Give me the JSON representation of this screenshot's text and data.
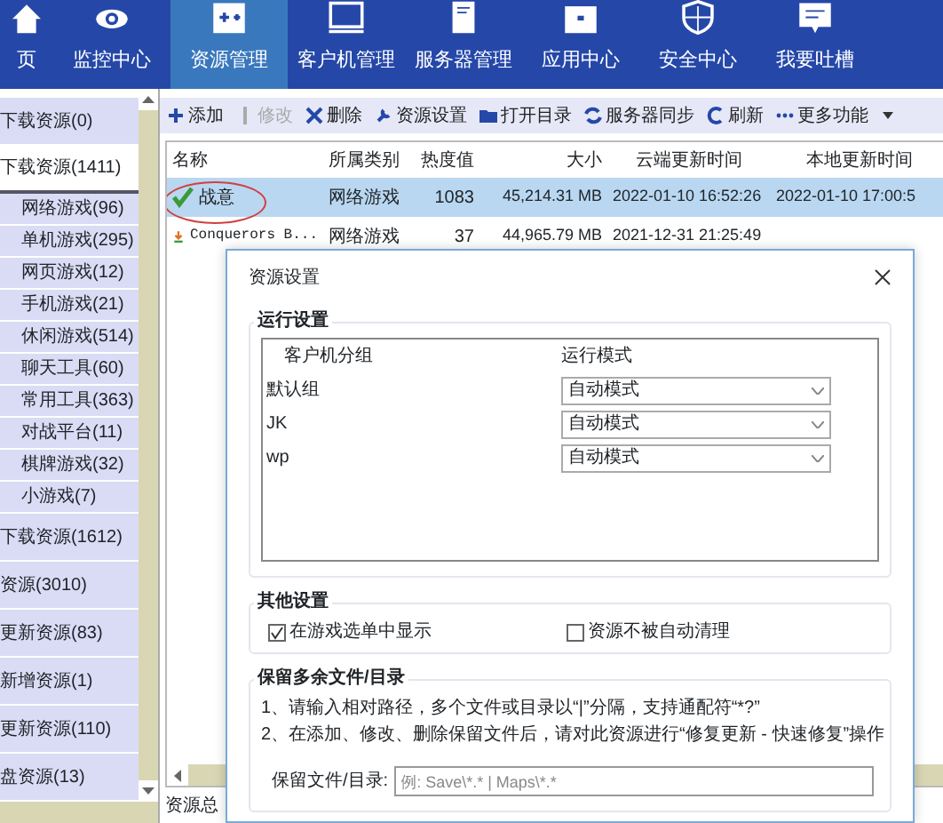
{
  "nav": [
    {
      "label": "页",
      "kind": "home",
      "selected": false
    },
    {
      "label": "监控中心",
      "kind": "eye",
      "selected": false
    },
    {
      "label": "资源管理",
      "kind": "plus",
      "selected": true
    },
    {
      "label": "客户机管理",
      "kind": "monitor",
      "selected": false
    },
    {
      "label": "服务器管理",
      "kind": "server",
      "selected": false
    },
    {
      "label": "应用中心",
      "kind": "box",
      "selected": false
    },
    {
      "label": "安全中心",
      "kind": "shield",
      "selected": false
    },
    {
      "label": "我要吐槽",
      "kind": "chat",
      "selected": false
    }
  ],
  "sidebar": {
    "items": [
      {
        "label": "下载资源(0)",
        "selected": false
      },
      {
        "label": "下载资源(1411)",
        "selected": true,
        "children": [
          {
            "label": "网络游戏(96)"
          },
          {
            "label": "单机游戏(295)"
          },
          {
            "label": "网页游戏(12)"
          },
          {
            "label": "手机游戏(21)"
          },
          {
            "label": "休闲游戏(514)"
          },
          {
            "label": "聊天工具(60)"
          },
          {
            "label": "常用工具(363)"
          },
          {
            "label": "对战平台(11)"
          },
          {
            "label": "棋牌游戏(32)"
          },
          {
            "label": "小游戏(7)"
          }
        ]
      },
      {
        "label": "下载资源(1612)",
        "selected": false
      },
      {
        "label": "资源(3010)",
        "selected": false
      },
      {
        "label": "更新资源(83)",
        "selected": false
      },
      {
        "label": "新增资源(1)",
        "selected": false
      },
      {
        "label": "更新资源(110)",
        "selected": false
      },
      {
        "label": "盘资源(13)",
        "selected": false
      }
    ]
  },
  "toolbar": [
    {
      "label": "添加",
      "kind": "add",
      "disabled": false
    },
    {
      "label": "修改",
      "kind": "edit",
      "disabled": true
    },
    {
      "label": "删除",
      "kind": "delete",
      "disabled": false
    },
    {
      "label": "资源设置",
      "kind": "wrench",
      "disabled": false
    },
    {
      "label": "打开目录",
      "kind": "folder",
      "disabled": false
    },
    {
      "label": "服务器同步",
      "kind": "sync",
      "disabled": false
    },
    {
      "label": "刷新",
      "kind": "refresh",
      "disabled": false
    },
    {
      "label": "更多功能",
      "kind": "more",
      "disabled": false
    }
  ],
  "table": {
    "columns": [
      "名称",
      "所属类别",
      "热度值",
      "大小",
      "云端更新时间",
      "本地更新时间"
    ],
    "rows": [
      {
        "kind": "check",
        "selected": true,
        "circled": true,
        "cells": [
          "战意",
          "网络游戏",
          "1083",
          "45,214.31 MB",
          "2022-01-10 16:52:26",
          "2022-01-10 17:00:5"
        ]
      },
      {
        "kind": "download",
        "selected": false,
        "circled": false,
        "cells": [
          "Conquerors B...",
          "网络游戏",
          "37",
          "44,965.79 MB",
          "2021-12-31 21:25:49",
          ""
        ]
      }
    ]
  },
  "status_bar": "资源总",
  "dialog": {
    "title": "资源设置",
    "run_settings": {
      "title": "运行设置",
      "columns": [
        "客户机分组",
        "运行模式"
      ],
      "rows": [
        {
          "group": "默认组",
          "mode": "自动模式"
        },
        {
          "group": "JK",
          "mode": "自动模式"
        },
        {
          "group": "wp",
          "mode": "自动模式"
        }
      ]
    },
    "other_settings": {
      "title": "其他设置",
      "options": [
        {
          "label": "在游戏选单中显示",
          "checked": true
        },
        {
          "label": "资源不被自动清理",
          "checked": false
        }
      ]
    },
    "keep_files": {
      "title": "保留多余文件/目录",
      "notes": [
        "1、请输入相对路径，多个文件或目录以“|”分隔，支持通配符“*?”",
        "2、在添加、修改、删除保留文件后，请对此资源进行“修复更新 - 快速修复”操作"
      ],
      "field": {
        "label": "保留文件/目录:",
        "placeholder": "例: Save\\*.* | Maps\\*.*"
      }
    }
  }
}
